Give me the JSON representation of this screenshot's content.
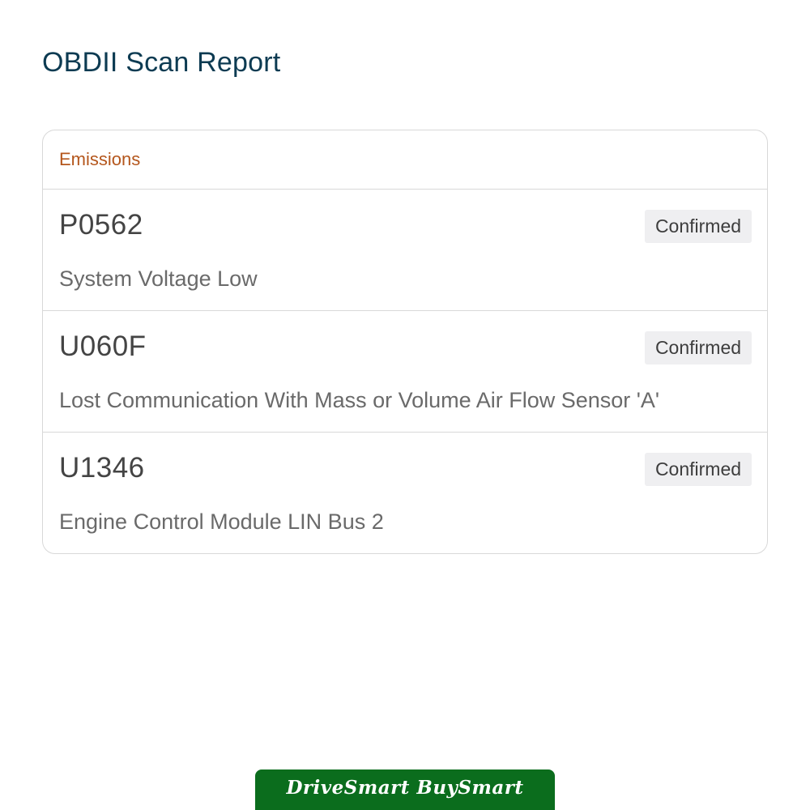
{
  "page": {
    "title": "OBDII Scan Report"
  },
  "report": {
    "category": "Emissions",
    "codes": [
      {
        "code": "P0562",
        "status": "Confirmed",
        "description": "System Voltage Low"
      },
      {
        "code": "U060F",
        "status": "Confirmed",
        "description": "Lost Communication With Mass or Volume Air Flow Sensor 'A'"
      },
      {
        "code": "U1346",
        "status": "Confirmed",
        "description": "Engine Control Module LIN Bus 2"
      }
    ]
  },
  "footer": {
    "brand": "DriveSmart BuySmart",
    "brand_color": "#0b6d1d"
  },
  "colors": {
    "title": "#0d3b52",
    "category": "#b4561c",
    "status_badge_bg": "#efeff1"
  }
}
